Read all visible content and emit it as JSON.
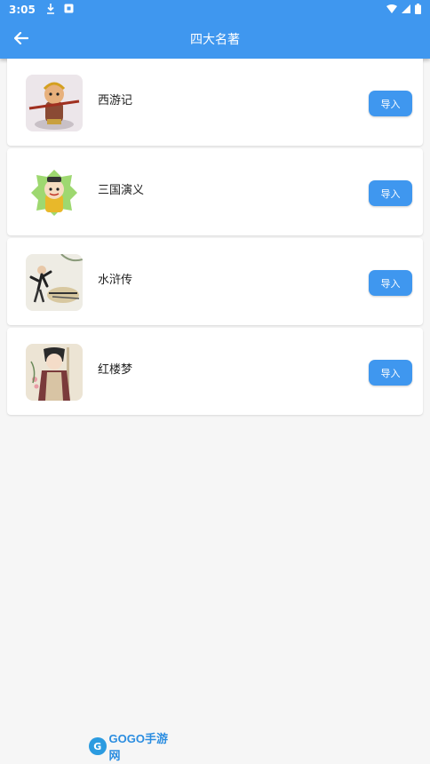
{
  "status": {
    "time": "3:05"
  },
  "header": {
    "title": "四大名著"
  },
  "books": [
    {
      "name": "西游记",
      "button": "导入"
    },
    {
      "name": "三国演义",
      "button": "导入"
    },
    {
      "name": "水浒传",
      "button": "导入"
    },
    {
      "name": "红楼梦",
      "button": "导入"
    }
  ],
  "watermark": {
    "text": "GOGO手游网"
  },
  "colors": {
    "primary": "#3f97ef",
    "background": "#f6f6f6",
    "card": "#ffffff"
  }
}
